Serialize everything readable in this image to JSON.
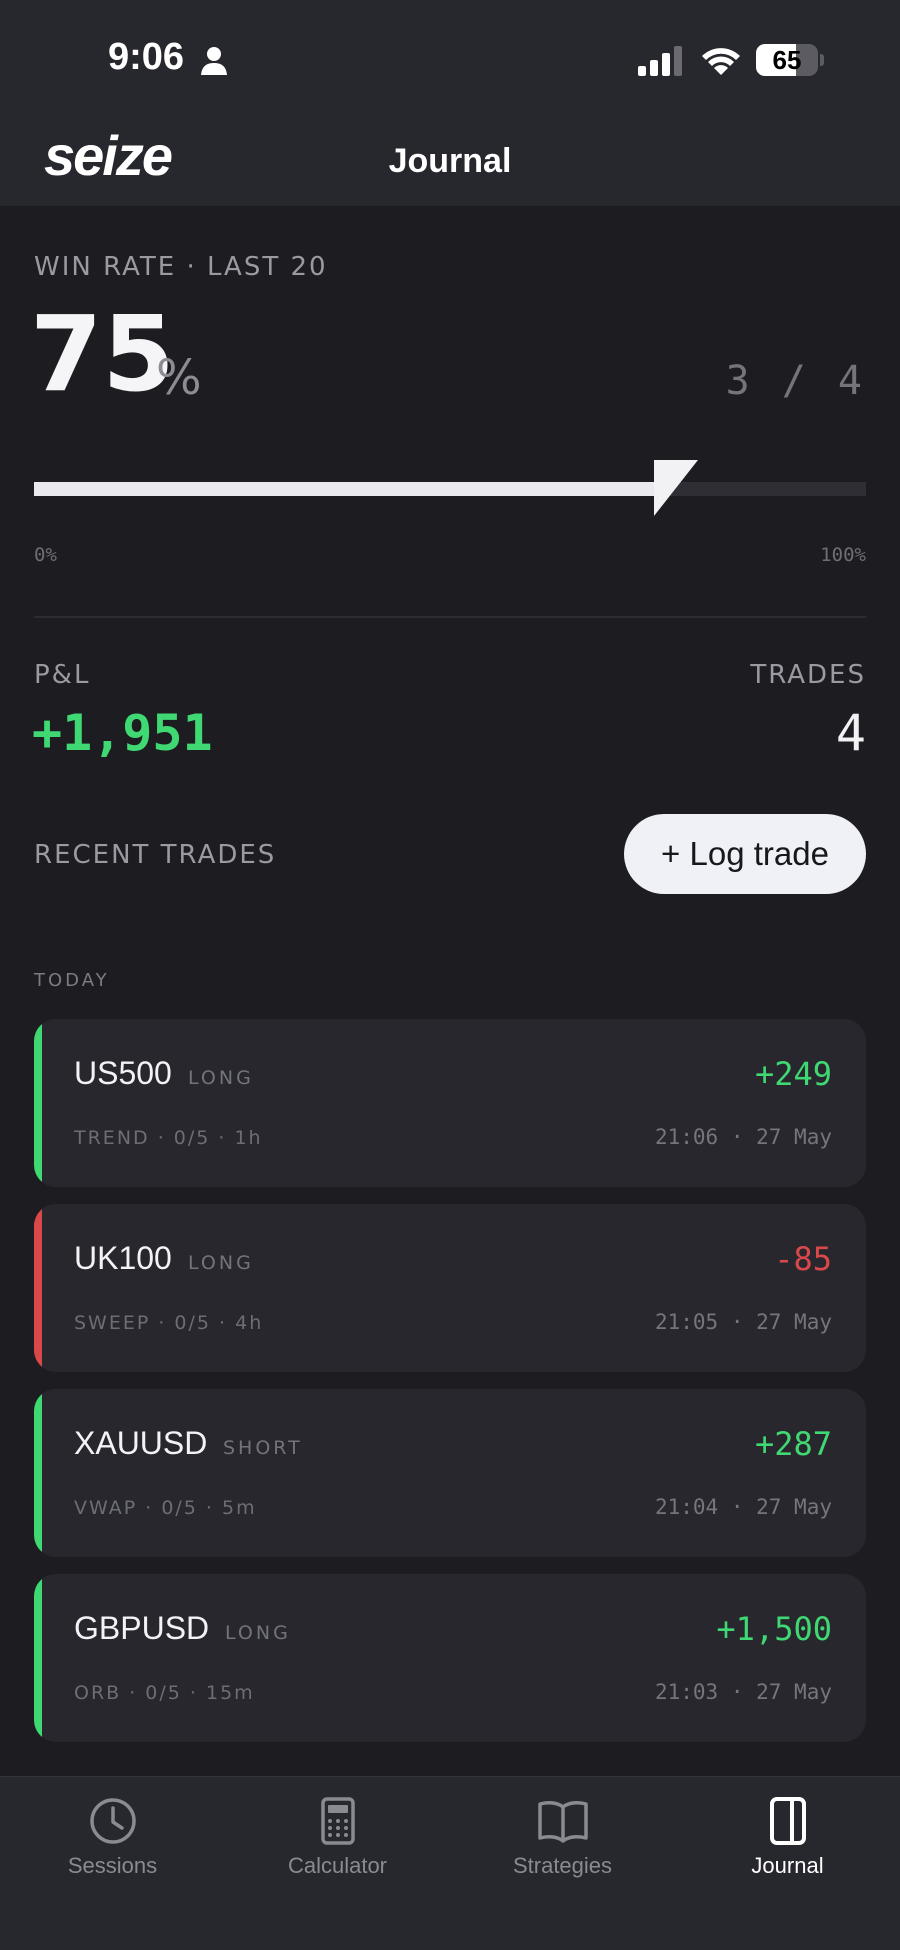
{
  "status_bar": {
    "time": "9:06",
    "battery": "65",
    "battery_level": 65
  },
  "header": {
    "logo_text": "seize",
    "title": "Journal"
  },
  "win_rate": {
    "label": "WIN RATE · LAST 20",
    "value": "75",
    "unit": "%",
    "ratio": "3 / 4",
    "progress_percent": 75,
    "scale_min": "0%",
    "scale_max": "100%"
  },
  "stats": {
    "pnl_label": "P&L",
    "pnl_value": "+1,951",
    "trades_label": "TRADES",
    "trades_value": "4"
  },
  "recent": {
    "label": "RECENT TRADES",
    "log_button": "+ Log trade",
    "group_label": "TODAY"
  },
  "colors": {
    "profit": "#3fd873",
    "loss": "#d9484a",
    "accent_bg": "#eff1f7"
  },
  "trades": [
    {
      "symbol": "US500",
      "side": "LONG",
      "pl": "+249",
      "result": "profit",
      "meta": "TREND · 0/5 · 1h",
      "time": "21:06 · 27 May"
    },
    {
      "symbol": "UK100",
      "side": "LONG",
      "pl": "-85",
      "result": "loss",
      "meta": "SWEEP · 0/5 · 4h",
      "time": "21:05 · 27 May"
    },
    {
      "symbol": "XAUUSD",
      "side": "SHORT",
      "pl": "+287",
      "result": "profit",
      "meta": "VWAP · 0/5 · 5m",
      "time": "21:04 · 27 May"
    },
    {
      "symbol": "GBPUSD",
      "side": "LONG",
      "pl": "+1,500",
      "result": "profit",
      "meta": "ORB · 0/5 · 15m",
      "time": "21:03 · 27 May"
    }
  ],
  "tabs": [
    {
      "label": "Sessions",
      "icon": "clock-icon",
      "active": false
    },
    {
      "label": "Calculator",
      "icon": "calculator-icon",
      "active": false
    },
    {
      "label": "Strategies",
      "icon": "book-icon",
      "active": false
    },
    {
      "label": "Journal",
      "icon": "journal-icon",
      "active": true
    }
  ]
}
